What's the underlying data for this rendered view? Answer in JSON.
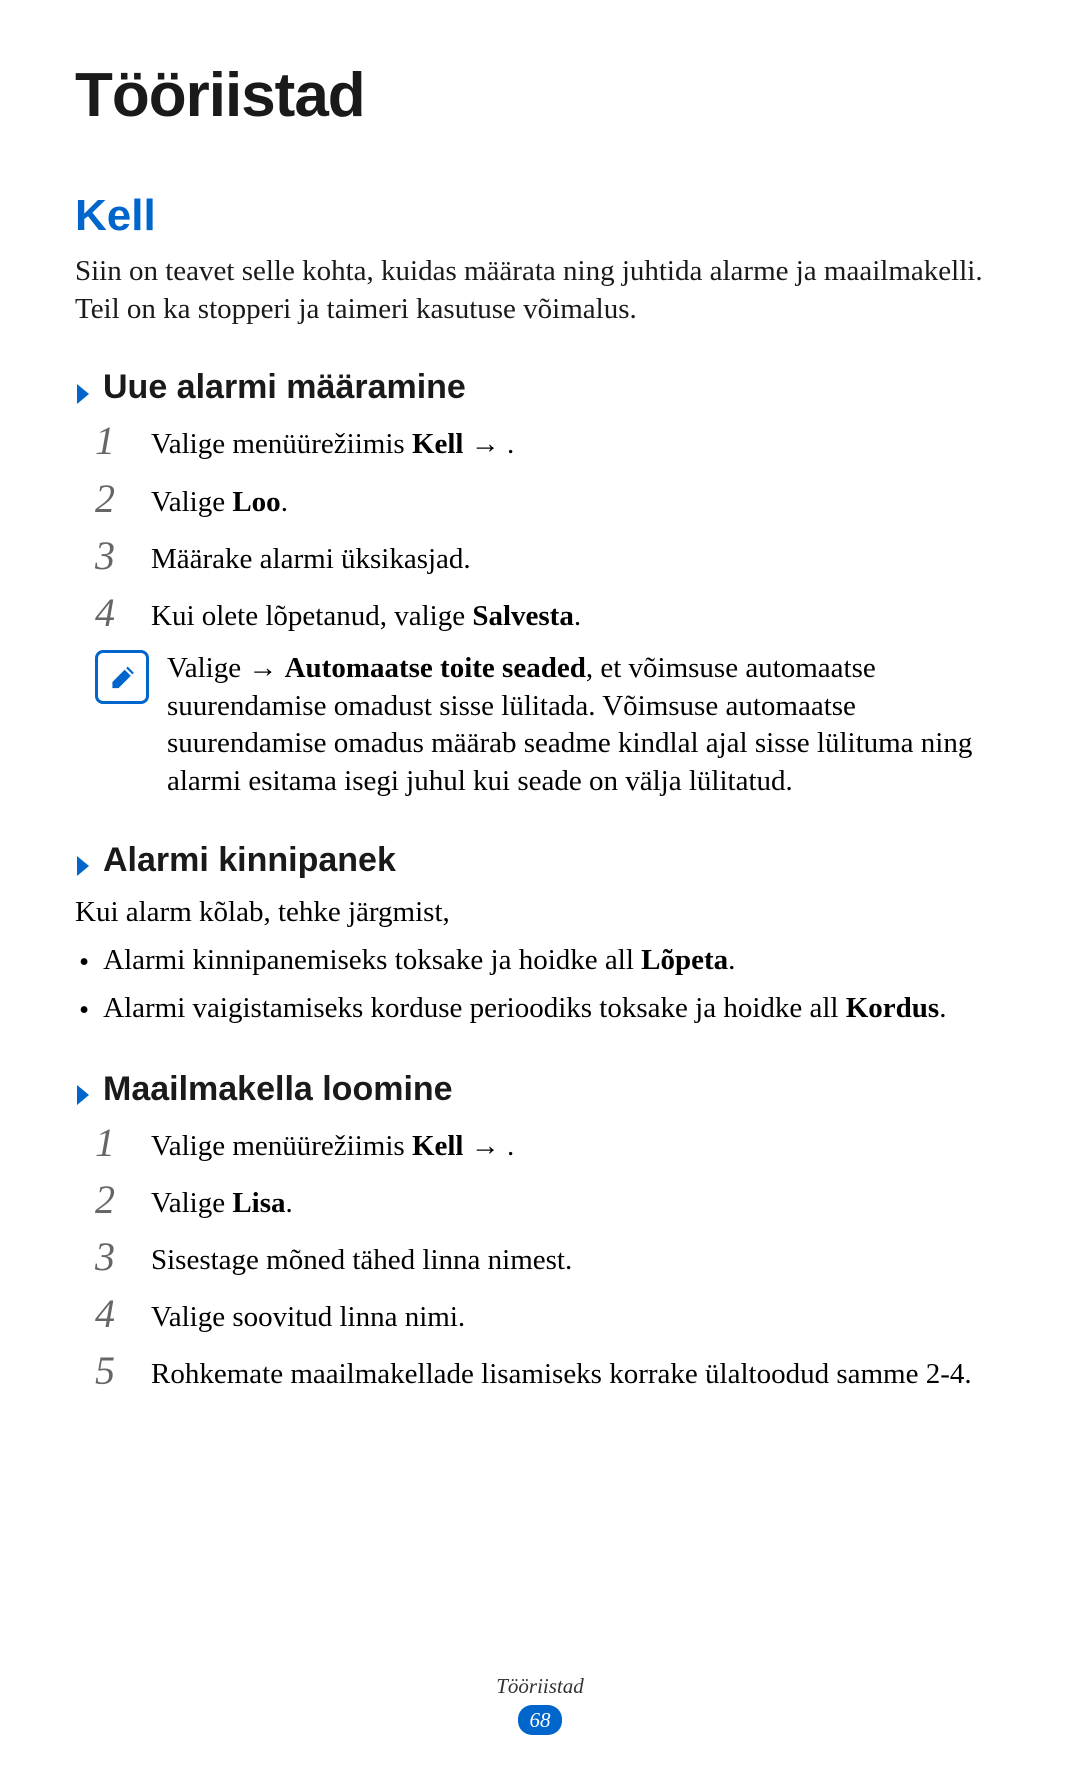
{
  "main_heading": "Tööriistad",
  "section_heading": "Kell",
  "intro_text": "Siin on teavet selle kohta, kuidas määrata ning juhtida alarme ja maailmakelli. Teil on ka stopperi ja taimeri kasutuse võimalus.",
  "subsection1": {
    "heading": "Uue alarmi määramine",
    "steps": [
      {
        "prefix": "Valige menüürežiimis ",
        "bold": "Kell",
        "suffix": " →      ."
      },
      {
        "prefix": "Valige ",
        "bold": "Loo",
        "suffix": "."
      },
      {
        "prefix": "Määrake alarmi üksikasjad.",
        "bold": "",
        "suffix": ""
      },
      {
        "prefix": "Kui olete lõpetanud, valige ",
        "bold": "Salvesta",
        "suffix": "."
      }
    ],
    "note": {
      "prefix": "Valige          → ",
      "bold": "Automaatse toite seaded",
      "suffix": ", et võimsuse automaatse suurendamise omadust sisse lülitada. Võimsuse automaatse suurendamise omadus määrab seadme kindlal ajal sisse lülituma ning alarmi esitama isegi juhul kui seade on välja lülitatud."
    }
  },
  "subsection2": {
    "heading": "Alarmi kinnipanek",
    "intro": "Kui alarm kõlab, tehke järgmist,",
    "bullets": [
      {
        "prefix": "Alarmi kinnipanemiseks toksake ja hoidke all ",
        "bold": "Lõpeta",
        "suffix": "."
      },
      {
        "prefix": "Alarmi vaigistamiseks korduse perioodiks toksake ja hoidke all ",
        "bold": "Kordus",
        "suffix": "."
      }
    ]
  },
  "subsection3": {
    "heading": "Maailmakella loomine",
    "steps": [
      {
        "prefix": "Valige menüürežiimis ",
        "bold": "Kell",
        "suffix": " →       ."
      },
      {
        "prefix": "Valige ",
        "bold": "Lisa",
        "suffix": "."
      },
      {
        "prefix": "Sisestage mõned tähed linna nimest.",
        "bold": "",
        "suffix": ""
      },
      {
        "prefix": "Valige soovitud linna nimi.",
        "bold": "",
        "suffix": ""
      },
      {
        "prefix": "Rohkemate maailmakellade lisamiseks korrake ülaltoodud samme 2-4.",
        "bold": "",
        "suffix": ""
      }
    ]
  },
  "footer": {
    "label": "Tööriistad",
    "page_number": "68"
  }
}
